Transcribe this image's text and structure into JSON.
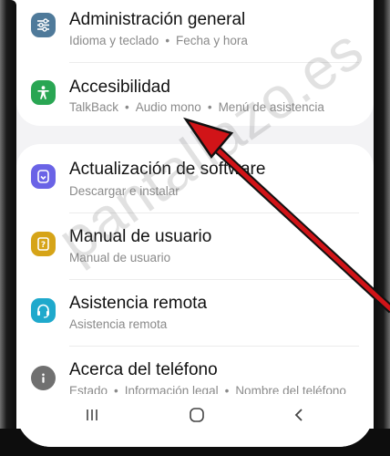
{
  "settings": {
    "items": [
      {
        "title": "Administración general",
        "subtitle": [
          "Idioma y teclado",
          "Fecha y hora"
        ],
        "icon": "sliders-icon",
        "icon_color": "#4f7a9a"
      },
      {
        "title": "Accesibilidad",
        "subtitle": [
          "TalkBack",
          "Audio mono",
          "Menú de asistencia"
        ],
        "icon": "accessibility-person-icon",
        "icon_color": "#29a653"
      },
      {
        "title": "Actualización de software",
        "subtitle": [
          "Descargar e instalar"
        ],
        "icon": "software-update-icon",
        "icon_color": "#6a63e6"
      },
      {
        "title": "Manual de usuario",
        "subtitle": [
          "Manual de usuario"
        ],
        "icon": "user-manual-icon",
        "icon_color": "#d6a418"
      },
      {
        "title": "Asistencia remota",
        "subtitle": [
          "Asistencia remota"
        ],
        "icon": "headset-icon",
        "icon_color": "#1fa9cc"
      },
      {
        "title": "Acerca del teléfono",
        "subtitle": [
          "Estado",
          "Información legal",
          "Nombre del teléfono"
        ],
        "icon": "info-icon",
        "icon_color": "#707070"
      }
    ]
  },
  "navbar": {
    "recents_icon": "recent-apps-icon",
    "home_icon": "home-icon",
    "back_icon": "back-icon"
  },
  "watermark": "pantallazo.es",
  "colors": {
    "arrow": "#d11418",
    "screen_bg": "#f3f3f5"
  }
}
